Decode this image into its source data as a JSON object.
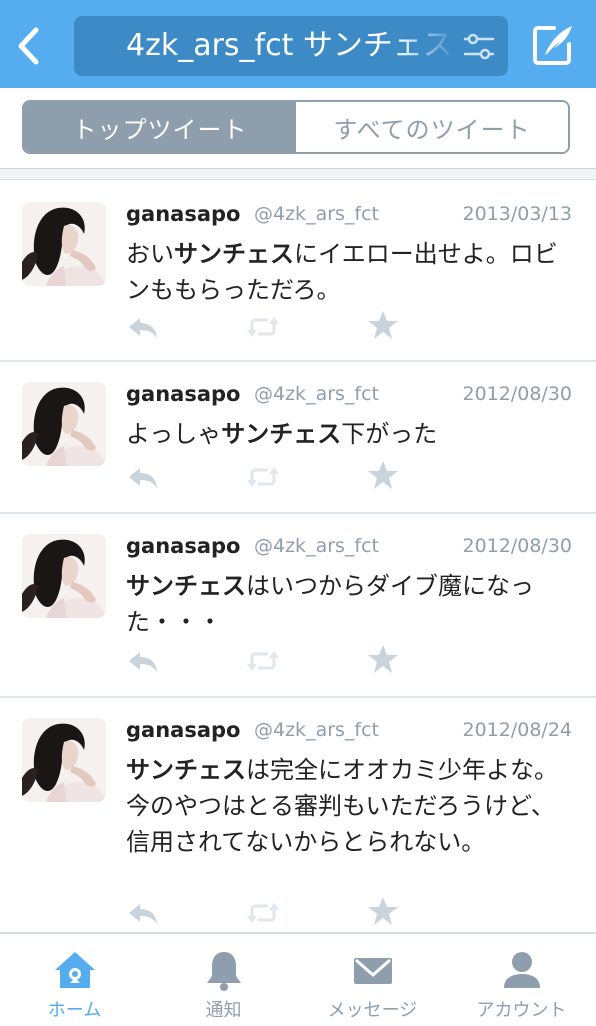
{
  "header": {
    "search_query": "4zk_ars_fct サンチェス",
    "back_icon": "chevron-left-icon",
    "filter_icon": "filter-sliders-icon",
    "compose_icon": "compose-tweet-icon",
    "bar_color": "#55ACEE"
  },
  "segments": {
    "top_label": "トップツイート",
    "all_label": "すべてのツイート",
    "active": "top"
  },
  "tweets": [
    {
      "name": "ganasapo",
      "handle": "@4zk_ars_fct",
      "date": "2013/03/13",
      "text_before": "おい",
      "highlight": "サンチェス",
      "text_after": "にイエロー出せよ。ロビンももらっただろ。"
    },
    {
      "name": "ganasapo",
      "handle": "@4zk_ars_fct",
      "date": "2012/08/30",
      "text_before": "よっしゃ",
      "highlight": "サンチェス",
      "text_after": "下がった"
    },
    {
      "name": "ganasapo",
      "handle": "@4zk_ars_fct",
      "date": "2012/08/30",
      "text_before": "",
      "highlight": "サンチェス",
      "text_after": "はいつからダイブ魔になった・・・"
    },
    {
      "name": "ganasapo",
      "handle": "@4zk_ars_fct",
      "date": "2012/08/24",
      "text_before": "",
      "highlight": "サンチェス",
      "text_after": "は完全にオオカミ少年よな。今のやつはとる審判もいただろうけど、信用されてないからとられない。"
    }
  ],
  "tabbar": {
    "home_label": "ホーム",
    "notifications_label": "通知",
    "messages_label": "メッセージ",
    "account_label": "アカウント",
    "active": "home",
    "active_color": "#55ACEE",
    "inactive_color": "#8F9EAD"
  }
}
